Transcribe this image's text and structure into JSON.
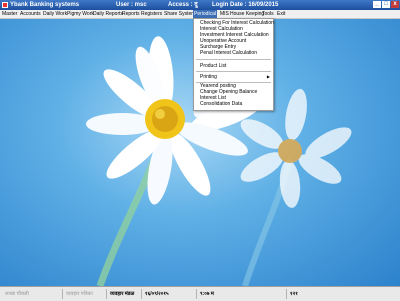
{
  "window": {
    "title": "Ybank Banking systems",
    "user": "User : msc",
    "access": "Access : दु",
    "login_date": "Login Date : 16/09/2015",
    "controls": [
      "_",
      "□",
      "x"
    ]
  },
  "menu_bar": [
    "Master",
    "Accounts",
    "Daily Work",
    "Pigmy Work",
    "Daily Reports",
    "Reports",
    "Registers",
    "Share System",
    "Periodical",
    "MIS",
    "House Keeping",
    "Tools",
    "Exit"
  ],
  "active_menu": "Periodical",
  "dropdown": {
    "group1": [
      "Checking For Interest Calculation",
      "Interest Calculation",
      "Investment Interest Calculation",
      "Unoperative Account",
      "Surcharge Entry",
      "Penal Interest Calculation"
    ],
    "group2": [
      "Product List"
    ],
    "group3": [
      "Printing"
    ],
    "group4": [
      "Yearend posting",
      "Change Opening Balance",
      "Interest List",
      "Consolidation Data"
    ]
  },
  "status_bar": [
    "शाखा चौकडी",
    "व्यवहार पत्रिका",
    "व्यवहार मंडळ",
    "१६/०९/२०१५",
    "९:०७ म",
    "१२१"
  ],
  "colors": {
    "title_bar": "#1d4f9e",
    "menu_highlight": "#3d6fb6",
    "desktop_sky": "#2c82cc",
    "flower_center": "#f0c419"
  }
}
